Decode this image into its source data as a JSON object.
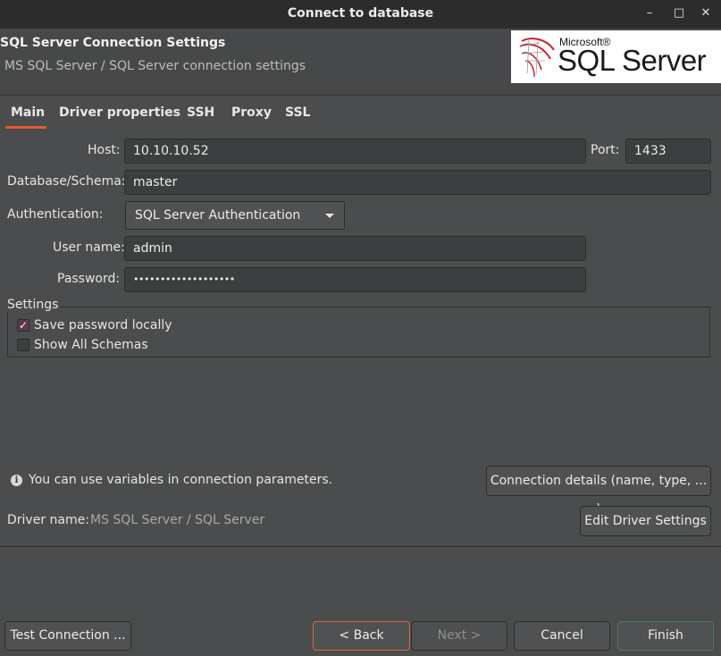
{
  "window": {
    "title": "Connect to database",
    "minimize": "–",
    "maximize": "□",
    "close": "✕"
  },
  "header": {
    "title": "SQL Server Connection Settings",
    "subtitle": "MS SQL Server / SQL Server connection settings",
    "logo": {
      "small": "Microsoft®",
      "large": "SQL Server"
    }
  },
  "tabs": [
    {
      "label": "Main",
      "active": true
    },
    {
      "label": "Driver properties"
    },
    {
      "label": "SSH"
    },
    {
      "label": "Proxy"
    },
    {
      "label": "SSL"
    }
  ],
  "form": {
    "host_label": "Host:",
    "host_value": "10.10.10.52",
    "port_label": "Port:",
    "port_value": "1433",
    "database_label": "Database/Schema:",
    "database_value": "master",
    "auth_label": "Authentication:",
    "auth_value": "SQL Server Authentication",
    "username_label": "User name:",
    "username_value": "admin",
    "password_label": "Password:",
    "password_value": "•••••••••••••••••••"
  },
  "settings": {
    "title": "Settings",
    "save_password": {
      "label": "Save password locally",
      "checked": true
    },
    "show_all_schemas": {
      "label": "Show All Schemas",
      "checked": false
    }
  },
  "info": {
    "variables_text": "You can use variables in connection parameters.",
    "connection_details_label": "Connection details (name, type, ... )",
    "driver_label": "Driver name:",
    "driver_value": "MS SQL Server / SQL Server",
    "edit_driver_label": "Edit Driver Settings"
  },
  "footer": {
    "test_connection": "Test Connection ...",
    "back": "< Back",
    "next": "Next >",
    "cancel": "Cancel",
    "finish": "Finish"
  },
  "colors": {
    "accent": "#e05a2b",
    "background": "#4a4c4d",
    "titlebar": "#2c2c2c"
  }
}
